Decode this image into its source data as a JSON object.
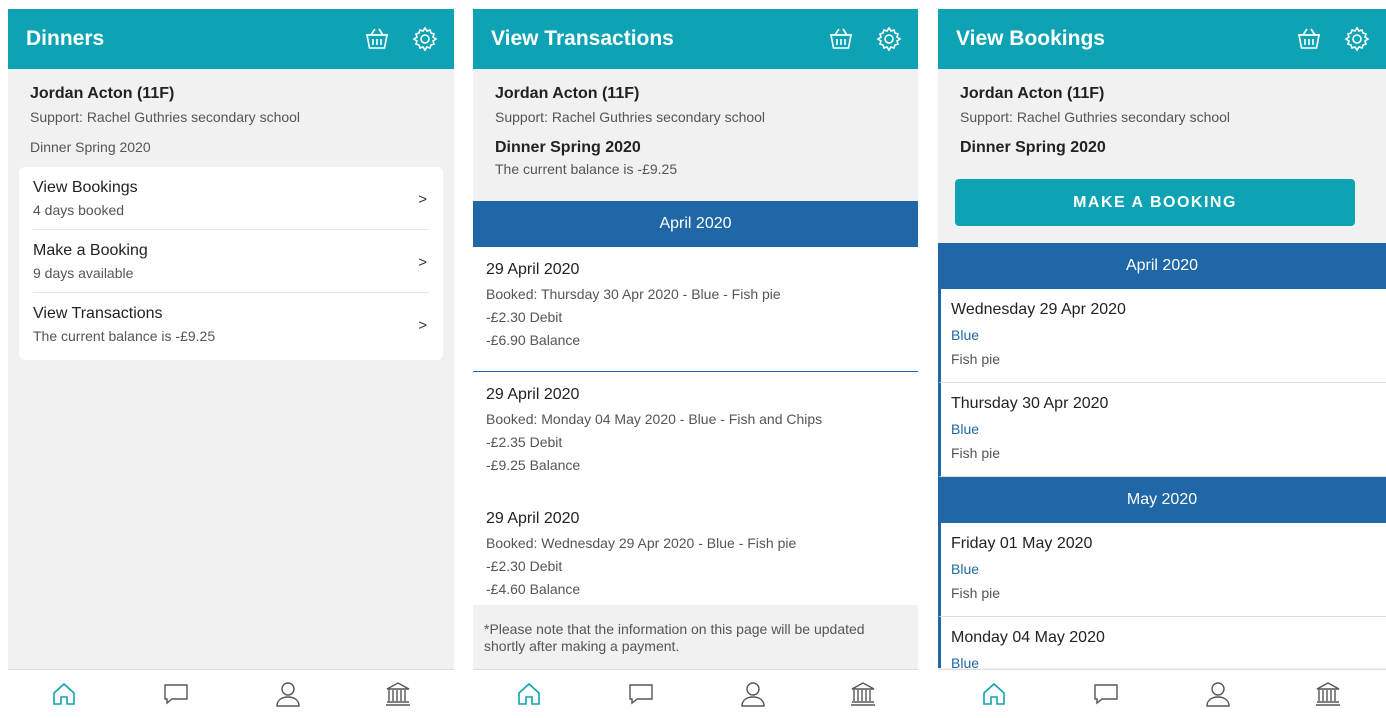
{
  "colors": {
    "header": "#0ea3b4",
    "month_band": "#1f67a6",
    "accent_text": "#1f67a6",
    "background": "#f1f1f1"
  },
  "icons": [
    "basket-icon",
    "gear-icon",
    "home-icon",
    "chat-icon",
    "profile-icon",
    "bank-icon"
  ],
  "screen1": {
    "title": "Dinners",
    "student": "Jordan Acton (11F)",
    "support": "Support: Rachel Guthries secondary school",
    "term": "Dinner Spring 2020",
    "menu": [
      {
        "title": "View Bookings",
        "sub": "4 days booked",
        "chevron": ">"
      },
      {
        "title": "Make a Booking",
        "sub": "9 days available",
        "chevron": ">"
      },
      {
        "title": "View Transactions",
        "sub": "The current balance is -£9.25",
        "chevron": ">"
      }
    ]
  },
  "screen2": {
    "title": "View Transactions",
    "student": "Jordan Acton (11F)",
    "support": "Support: Rachel Guthries secondary school",
    "term": "Dinner Spring 2020",
    "balance": "The current balance is -£9.25",
    "month": "April 2020",
    "transactions": [
      {
        "date": "29 April 2020",
        "booked": "Booked: Thursday 30 Apr 2020 - Blue - Fish pie",
        "debit": "-£2.30 Debit",
        "balance": "-£6.90 Balance"
      },
      {
        "date": "29 April 2020",
        "booked": "Booked: Monday 04 May 2020 - Blue - Fish and Chips",
        "debit": "-£2.35 Debit",
        "balance": "-£9.25 Balance"
      },
      {
        "date": "29 April 2020",
        "booked": "Booked: Wednesday 29 Apr 2020 - Blue - Fish pie",
        "debit": "-£2.30 Debit",
        "balance": "-£4.60 Balance"
      }
    ],
    "note": "*Please note that the information on this page will be updated shortly after making a payment."
  },
  "screen3": {
    "title": "View Bookings",
    "student": "Jordan Acton (11F)",
    "support": "Support: Rachel Guthries secondary school",
    "term": "Dinner Spring 2020",
    "button": "MAKE A BOOKING",
    "months": [
      {
        "label": "April 2020",
        "items": [
          {
            "date": "Wednesday 29 Apr 2020",
            "colour": "Blue",
            "food": "Fish pie"
          },
          {
            "date": "Thursday 30 Apr 2020",
            "colour": "Blue",
            "food": "Fish pie"
          }
        ]
      },
      {
        "label": "May 2020",
        "items": [
          {
            "date": "Friday 01 May 2020",
            "colour": "Blue",
            "food": "Fish pie"
          },
          {
            "date": "Monday 04 May 2020",
            "colour": "Blue",
            "food": ""
          }
        ]
      }
    ]
  }
}
